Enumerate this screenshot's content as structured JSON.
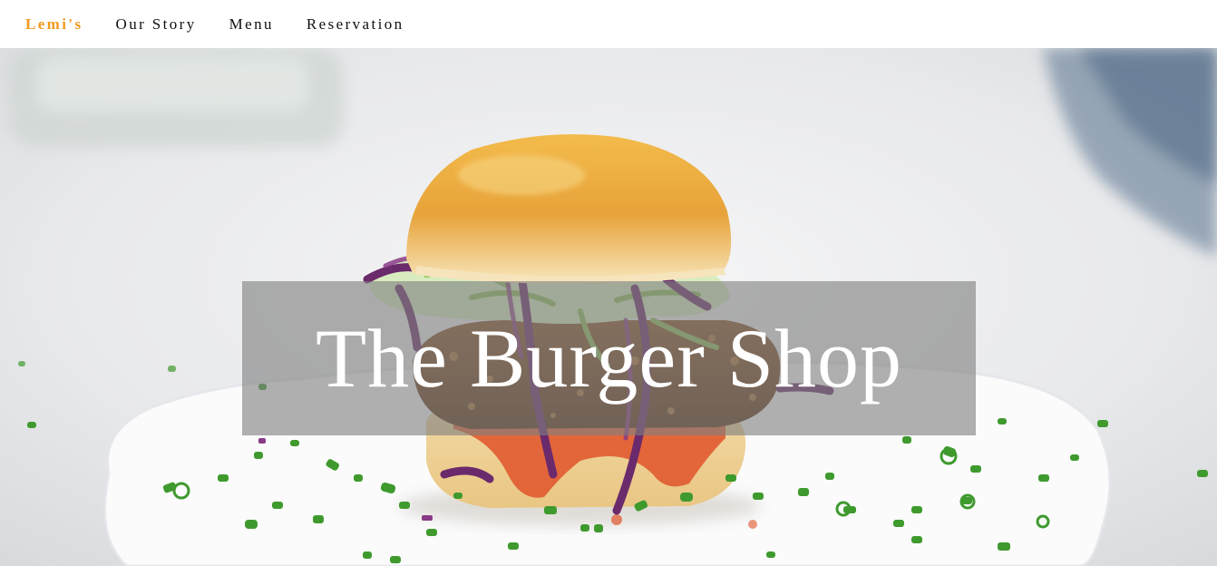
{
  "nav": {
    "brand": "Lemi's",
    "links": [
      "Our Story",
      "Menu",
      "Reservation"
    ],
    "brand_color": "#f39a1f",
    "link_color": "#111111"
  },
  "hero": {
    "title": "The Burger Shop",
    "image": "burger-photo",
    "overlay_color": "rgba(128,128,128,0.62)"
  }
}
